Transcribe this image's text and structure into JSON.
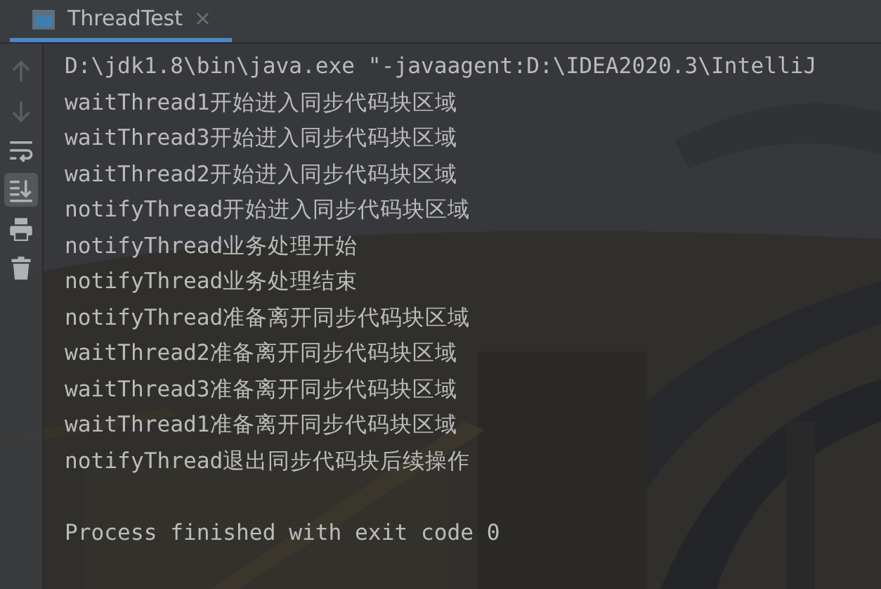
{
  "tabs": [
    {
      "title": "ThreadTest",
      "selected": true,
      "close": "×"
    }
  ],
  "toolbar": [
    {
      "kind": "up",
      "disabled": true,
      "selected": false
    },
    {
      "kind": "down",
      "disabled": true,
      "selected": false
    },
    {
      "kind": "wrap",
      "disabled": false,
      "selected": false
    },
    {
      "kind": "scroll-end",
      "disabled": false,
      "selected": true
    },
    {
      "kind": "print",
      "disabled": false,
      "selected": false
    },
    {
      "kind": "trash",
      "disabled": false,
      "selected": false
    }
  ],
  "console": {
    "lines": [
      "D:\\jdk1.8\\bin\\java.exe \"-javaagent:D:\\IDEA2020.3\\IntelliJ",
      "waitThread1开始进入同步代码块区域",
      "waitThread3开始进入同步代码块区域",
      "waitThread2开始进入同步代码块区域",
      "notifyThread开始进入同步代码块区域",
      "notifyThread业务处理开始",
      "notifyThread业务处理结束",
      "notifyThread准备离开同步代码块区域",
      "waitThread2准备离开同步代码块区域",
      "waitThread3准备离开同步代码块区域",
      "waitThread1准备离开同步代码块区域",
      "notifyThread退出同步代码块后续操作"
    ],
    "exit_message": "Process finished with exit code 0"
  }
}
